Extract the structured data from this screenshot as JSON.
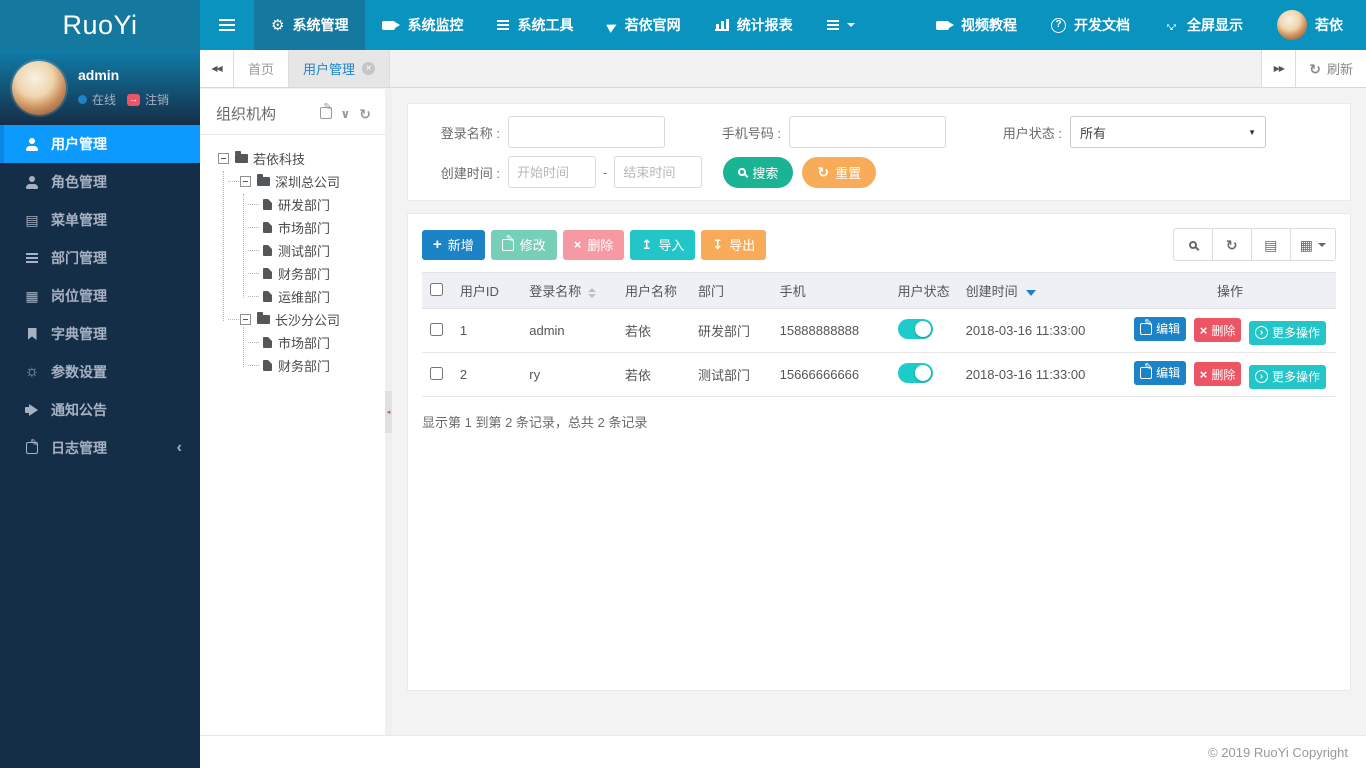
{
  "navbar": {
    "logo_text": "RuoYi",
    "hamburger_icon": "hamburger-icon",
    "menu": [
      {
        "label": "系统管理",
        "icon": "gear-icon",
        "active": true
      },
      {
        "label": "系统监控",
        "icon": "video-camera-icon",
        "active": false
      },
      {
        "label": "系统工具",
        "icon": "list-bars-icon",
        "active": false
      },
      {
        "label": "若依官网",
        "icon": "paper-plane-icon",
        "active": false
      },
      {
        "label": "统计报表",
        "icon": "bar-chart-icon",
        "active": false
      }
    ],
    "more_menu_icon": "menu-caret-icon",
    "right_menu": [
      {
        "label": "视频教程",
        "icon": "video-camera-icon"
      },
      {
        "label": "开发文档",
        "icon": "question-circle-icon"
      },
      {
        "label": "全屏显示",
        "icon": "arrows-expand-icon"
      },
      {
        "label": "若依",
        "icon": "user-avatar"
      }
    ]
  },
  "sidebar": {
    "user": {
      "name": "admin",
      "status_label": "在线",
      "status_icon": "online-dot",
      "logout_label": "注销",
      "logout_icon": "sign-out-icon"
    },
    "menu": [
      {
        "label": "用户管理",
        "icon": "user-icon",
        "active": true
      },
      {
        "label": "角色管理",
        "icon": "user-secret-icon",
        "active": false
      },
      {
        "label": "菜单管理",
        "icon": "th-list-icon",
        "active": false
      },
      {
        "label": "部门管理",
        "icon": "outdent-icon",
        "active": false
      },
      {
        "label": "岗位管理",
        "icon": "id-card-icon",
        "active": false
      },
      {
        "label": "字典管理",
        "icon": "bookmark-icon",
        "active": false
      },
      {
        "label": "参数设置",
        "icon": "sun-icon",
        "active": false
      },
      {
        "label": "通知公告",
        "icon": "bullhorn-icon",
        "active": false
      },
      {
        "label": "日志管理",
        "icon": "pencil-square-icon",
        "active": false,
        "has_children": true
      }
    ]
  },
  "org_panel": {
    "title": "组织机构",
    "header_icons": [
      "edit-icon",
      "chevron-down-icon",
      "refresh-icon"
    ],
    "nodes": [
      {
        "label": "若依科技",
        "type": "folder",
        "depth": 0,
        "expanded": true
      },
      {
        "label": "深圳总公司",
        "type": "folder",
        "depth": 1,
        "expanded": true
      },
      {
        "label": "研发部门",
        "type": "file",
        "depth": 2
      },
      {
        "label": "市场部门",
        "type": "file",
        "depth": 2
      },
      {
        "label": "测试部门",
        "type": "file",
        "depth": 2
      },
      {
        "label": "财务部门",
        "type": "file",
        "depth": 2
      },
      {
        "label": "运维部门",
        "type": "file",
        "depth": 2
      },
      {
        "label": "长沙分公司",
        "type": "folder",
        "depth": 1,
        "expanded": true
      },
      {
        "label": "市场部门",
        "type": "file",
        "depth": 2
      },
      {
        "label": "财务部门",
        "type": "file",
        "depth": 2
      }
    ]
  },
  "tabs": {
    "back_icon": "backward-icon",
    "forward_icon": "forward-icon",
    "items": [
      {
        "label": "首页",
        "active": false,
        "closable": false
      },
      {
        "label": "用户管理",
        "active": true,
        "closable": true
      }
    ],
    "refresh_label": "刷新",
    "refresh_icon": "refresh-icon"
  },
  "search_form": {
    "login_name_label": "登录名称 :",
    "login_name_value": "",
    "phone_label": "手机号码 :",
    "phone_value": "",
    "status_label": "用户状态 :",
    "status_value": "所有",
    "create_time_label": "创建时间 :",
    "start_placeholder": "开始时间",
    "end_placeholder": "结束时间",
    "range_separator": "-",
    "search_label": "搜索",
    "reset_label": "重置"
  },
  "toolbar": {
    "add_label": "新增",
    "edit_label": "修改",
    "delete_label": "删除",
    "import_label": "导入",
    "export_label": "导出",
    "right_icons": [
      "search-icon",
      "refresh-icon",
      "list-alt-icon",
      "grid-columns-icon"
    ]
  },
  "table": {
    "columns": [
      "用户ID",
      "登录名称",
      "用户名称",
      "部门",
      "手机",
      "用户状态",
      "创建时间",
      "操作"
    ],
    "sorted_column": "创建时间",
    "rows": [
      {
        "id": "1",
        "login": "admin",
        "name": "若依",
        "dept": "研发部门",
        "phone": "15888888888",
        "status_on": true,
        "created": "2018-03-16 11:33:00"
      },
      {
        "id": "2",
        "login": "ry",
        "name": "若依",
        "dept": "测试部门",
        "phone": "15666666666",
        "status_on": true,
        "created": "2018-03-16 11:33:00"
      }
    ],
    "row_actions": {
      "edit": "编辑",
      "delete": "删除",
      "more": "更多操作"
    },
    "summary": "显示第 1 到第 2 条记录，总共 2 条记录"
  },
  "footer": {
    "copyright": "© 2019 RuoYi Copyright"
  },
  "theme_colors": {
    "navbar": "#0b93bf",
    "navbar_active": "#15799f",
    "sidebar": "#152e47",
    "sidebar_active": "#0d9aff",
    "primary": "#1c84c6",
    "success": "#1ab394",
    "danger": "#ed5565",
    "warning": "#f8ac59",
    "info": "#23c6c8",
    "toggle_on": "#1ecbcb"
  }
}
